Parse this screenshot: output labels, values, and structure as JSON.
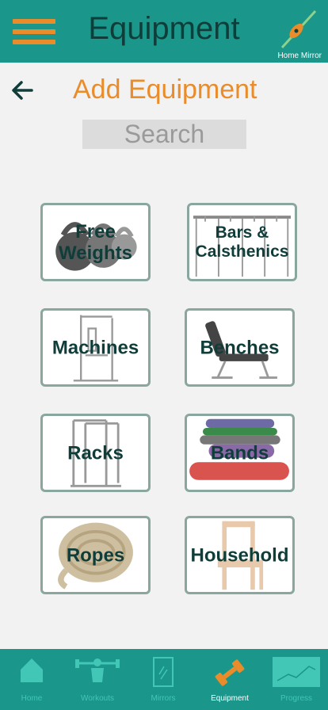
{
  "header": {
    "title": "Equipment",
    "mirror_label": "Home Mirror",
    "menu_icon": "hamburger-icon",
    "mirror_icon": "mirror-wand-icon"
  },
  "page": {
    "back_icon": "back-arrow-icon",
    "title": "Add Equipment",
    "search_placeholder": "Search"
  },
  "tiles": [
    {
      "label": "Free Weights",
      "image": "kettlebells"
    },
    {
      "label": "Bars & Calsthenics",
      "image": "monkey-bars"
    },
    {
      "label": "Machines",
      "image": "home-gym-machine"
    },
    {
      "label": "Benches",
      "image": "adjustable-bench"
    },
    {
      "label": "Racks",
      "image": "power-rack"
    },
    {
      "label": "Bands",
      "image": "resistance-bands"
    },
    {
      "label": "Ropes",
      "image": "coiled-rope"
    },
    {
      "label": "Household",
      "image": "wooden-chair"
    }
  ],
  "nav": [
    {
      "label": "Home",
      "icon": "home-icon"
    },
    {
      "label": "Workouts",
      "icon": "weightlifter-icon"
    },
    {
      "label": "Mirrors",
      "icon": "mirror-icon"
    },
    {
      "label": "Equipment",
      "icon": "dumbbell-icon",
      "active": true
    },
    {
      "label": "Progress",
      "icon": "chart-icon"
    }
  ],
  "colors": {
    "primary": "#1a968a",
    "accent": "#ea8c2a",
    "dark_text": "#0f3d3a",
    "background": "#f2f2f2",
    "tile_border": "#8aa79f",
    "nav_inactive": "#42c6b6"
  }
}
